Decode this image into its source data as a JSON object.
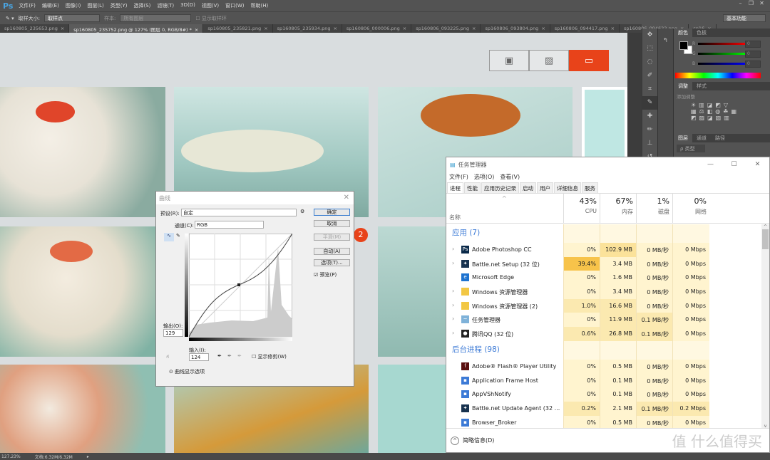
{
  "app": {
    "logo": "Ps",
    "menu": [
      "文件(F)",
      "编辑(E)",
      "图像(I)",
      "图层(L)",
      "类型(Y)",
      "选择(S)",
      "滤镜(T)",
      "3D(D)",
      "视图(V)",
      "窗口(W)",
      "帮助(H)"
    ]
  },
  "options": {
    "sample_size_label": "取样大小:",
    "sample_size_value": "取样点",
    "sample_label": "样本:",
    "sample_value": "所有图层",
    "show_ring": "显示取样环",
    "workspace": "基本功能"
  },
  "doc_tabs": [
    "sp160805_235653.png",
    "sp160805_235752.png @ 127% (图层 0, RGB/8#) *",
    "sp160805_235821.png",
    "sp160805_235934.png",
    "sp160806_000006.png",
    "sp160806_093225.png",
    "sp160806_093804.png",
    "sp160806_094417.png",
    "sp160806_094622.png",
    "sp16"
  ],
  "canvas": {
    "badge": "2"
  },
  "panels": {
    "color_tabs": [
      "颜色",
      "色板"
    ],
    "channels": [
      "R",
      "G",
      "B"
    ],
    "channel_values": [
      "0",
      "0",
      "0"
    ],
    "adjust_tabs": [
      "调整",
      "样式"
    ],
    "add_adjust": "添加调整",
    "layer_tabs": [
      "图层",
      "通道",
      "路径"
    ],
    "layer_filter": "ρ 类型"
  },
  "status": {
    "zoom": "127.23%",
    "doc": "文档:6.32M/6.32M"
  },
  "curves": {
    "title": "曲线",
    "preset_label": "预设(R):",
    "preset_value": "自定",
    "channel_label": "通道(C):",
    "channel_value": "RGB",
    "ok": "确定",
    "cancel": "取消",
    "smooth": "平滑(M)",
    "auto": "自动(A)",
    "options": "选项(T)...",
    "preview": "预览(P)",
    "preview_checked": true,
    "output_label": "输出(O):",
    "output_value": "129",
    "input_label": "输入(I):",
    "input_value": "124",
    "show_clipping": "显示修剪(W)",
    "display_options": "曲线显示选项"
  },
  "taskmanager": {
    "title": "任务管理器",
    "menu": [
      "文件(F)",
      "选项(O)",
      "查看(V)"
    ],
    "tabs": [
      "进程",
      "性能",
      "应用历史记录",
      "启动",
      "用户",
      "详细信息",
      "服务"
    ],
    "name_col": "名称",
    "cols": [
      {
        "pct": "43%",
        "label": "CPU"
      },
      {
        "pct": "67%",
        "label": "内存"
      },
      {
        "pct": "1%",
        "label": "磁盘"
      },
      {
        "pct": "0%",
        "label": "网络"
      }
    ],
    "apps_group": "应用 (7)",
    "apps": [
      {
        "name": "Adobe Photoshop CC",
        "icon": "photoshop-icon",
        "cpu": "0%",
        "mem": "102.9 MB",
        "disk": "0 MB/秒",
        "net": "0 Mbps",
        "exp": true
      },
      {
        "name": "Battle.net Setup (32 位)",
        "icon": "battlenet-icon",
        "cpu": "39.4%",
        "mem": "3.4 MB",
        "disk": "0 MB/秒",
        "net": "0 Mbps",
        "exp": true
      },
      {
        "name": "Microsoft Edge",
        "icon": "edge-icon",
        "cpu": "0%",
        "mem": "1.6 MB",
        "disk": "0 MB/秒",
        "net": "0 Mbps",
        "exp": false
      },
      {
        "name": "Windows 资源管理器",
        "icon": "folder-icon",
        "cpu": "0%",
        "mem": "3.4 MB",
        "disk": "0 MB/秒",
        "net": "0 Mbps",
        "exp": true
      },
      {
        "name": "Windows 资源管理器 (2)",
        "icon": "folder-icon",
        "cpu": "1.0%",
        "mem": "16.6 MB",
        "disk": "0 MB/秒",
        "net": "0 Mbps",
        "exp": true
      },
      {
        "name": "任务管理器",
        "icon": "taskmanager-icon",
        "cpu": "0%",
        "mem": "11.9 MB",
        "disk": "0.1 MB/秒",
        "net": "0 Mbps",
        "exp": true
      },
      {
        "name": "腾讯QQ (32 位)",
        "icon": "qq-icon",
        "cpu": "0.6%",
        "mem": "26.8 MB",
        "disk": "0.1 MB/秒",
        "net": "0 Mbps",
        "exp": true
      }
    ],
    "bg_group": "后台进程 (98)",
    "bg": [
      {
        "name": "Adobe® Flash® Player Utility",
        "icon": "flash-icon",
        "cpu": "0%",
        "mem": "0.5 MB",
        "disk": "0 MB/秒",
        "net": "0 Mbps"
      },
      {
        "name": "Application Frame Host",
        "icon": "app-icon",
        "cpu": "0%",
        "mem": "0.1 MB",
        "disk": "0 MB/秒",
        "net": "0 Mbps"
      },
      {
        "name": "AppVShNotify",
        "icon": "app-icon",
        "cpu": "0%",
        "mem": "0.1 MB",
        "disk": "0 MB/秒",
        "net": "0 Mbps"
      },
      {
        "name": "Battle.net Update Agent (32 ...",
        "icon": "battlenet-icon",
        "cpu": "0.2%",
        "mem": "2.1 MB",
        "disk": "0.1 MB/秒",
        "net": "0.2 Mbps"
      },
      {
        "name": "Browser_Broker",
        "icon": "app-icon",
        "cpu": "0%",
        "mem": "0.5 MB",
        "disk": "0 MB/秒",
        "net": "0 Mbps"
      }
    ],
    "fewer_details": "简略信息(D)"
  },
  "watermark": "值 什么值得买"
}
